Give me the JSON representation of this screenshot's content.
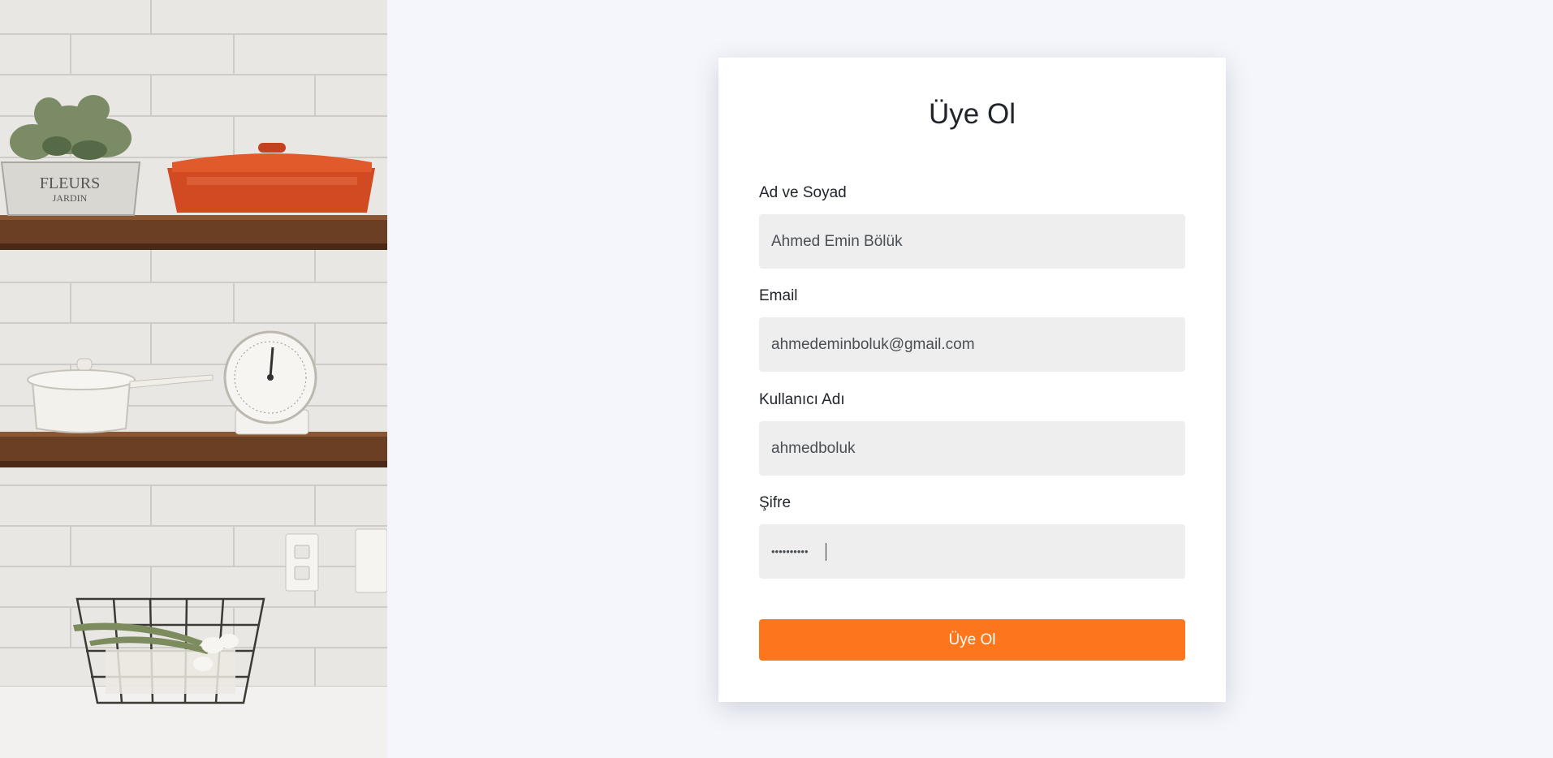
{
  "photo": {
    "alt": "kitchen-shelves-photo"
  },
  "form": {
    "title": "Üye Ol",
    "fields": [
      {
        "label": "Ad ve Soyad",
        "value": "Ahmed Emin Bölük",
        "type": "text"
      },
      {
        "label": "Email",
        "value": "ahmedeminboluk@gmail.com",
        "type": "email"
      },
      {
        "label": "Kullanıcı Adı",
        "value": "ahmedboluk",
        "type": "text"
      },
      {
        "label": "Şifre",
        "value": "••••••••••",
        "type": "password"
      }
    ],
    "submit_label": "Üye Ol"
  },
  "colors": {
    "accent": "#fd761b",
    "background": "#f5f6fb",
    "input_bg": "#eeeeee",
    "text": "#212529"
  }
}
